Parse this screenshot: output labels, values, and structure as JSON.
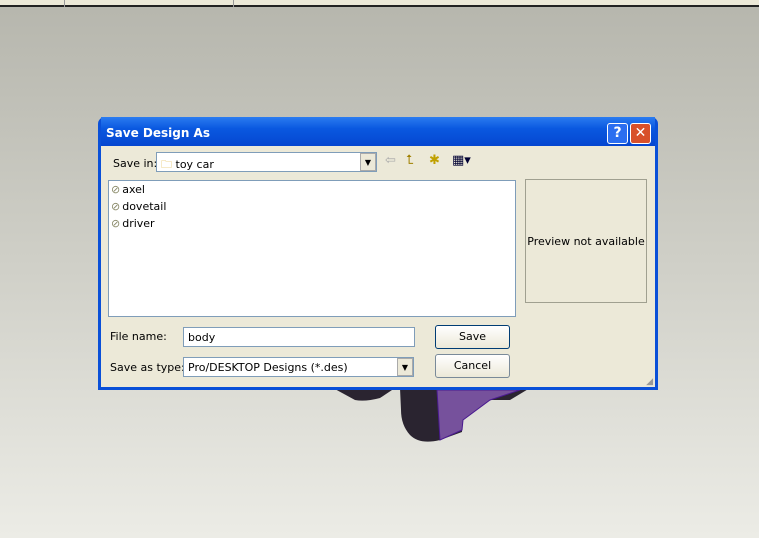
{
  "dialog": {
    "title": "Save Design As",
    "help": "?",
    "close": "✕",
    "save_in_label": "Save in:",
    "save_in_value": "toy car",
    "files": [
      {
        "name": "axel"
      },
      {
        "name": "dovetail"
      },
      {
        "name": "driver"
      }
    ],
    "preview_text": "Preview not available",
    "file_name_label": "File name:",
    "file_name_value": "body",
    "save_as_type_label": "Save as type:",
    "save_as_type_value": "Pro/DESKTOP Designs (*.des)",
    "save_button": "Save",
    "cancel_button": "Cancel"
  },
  "colors": {
    "model": "#6a3f96",
    "title_bar": "#0a50d8"
  }
}
